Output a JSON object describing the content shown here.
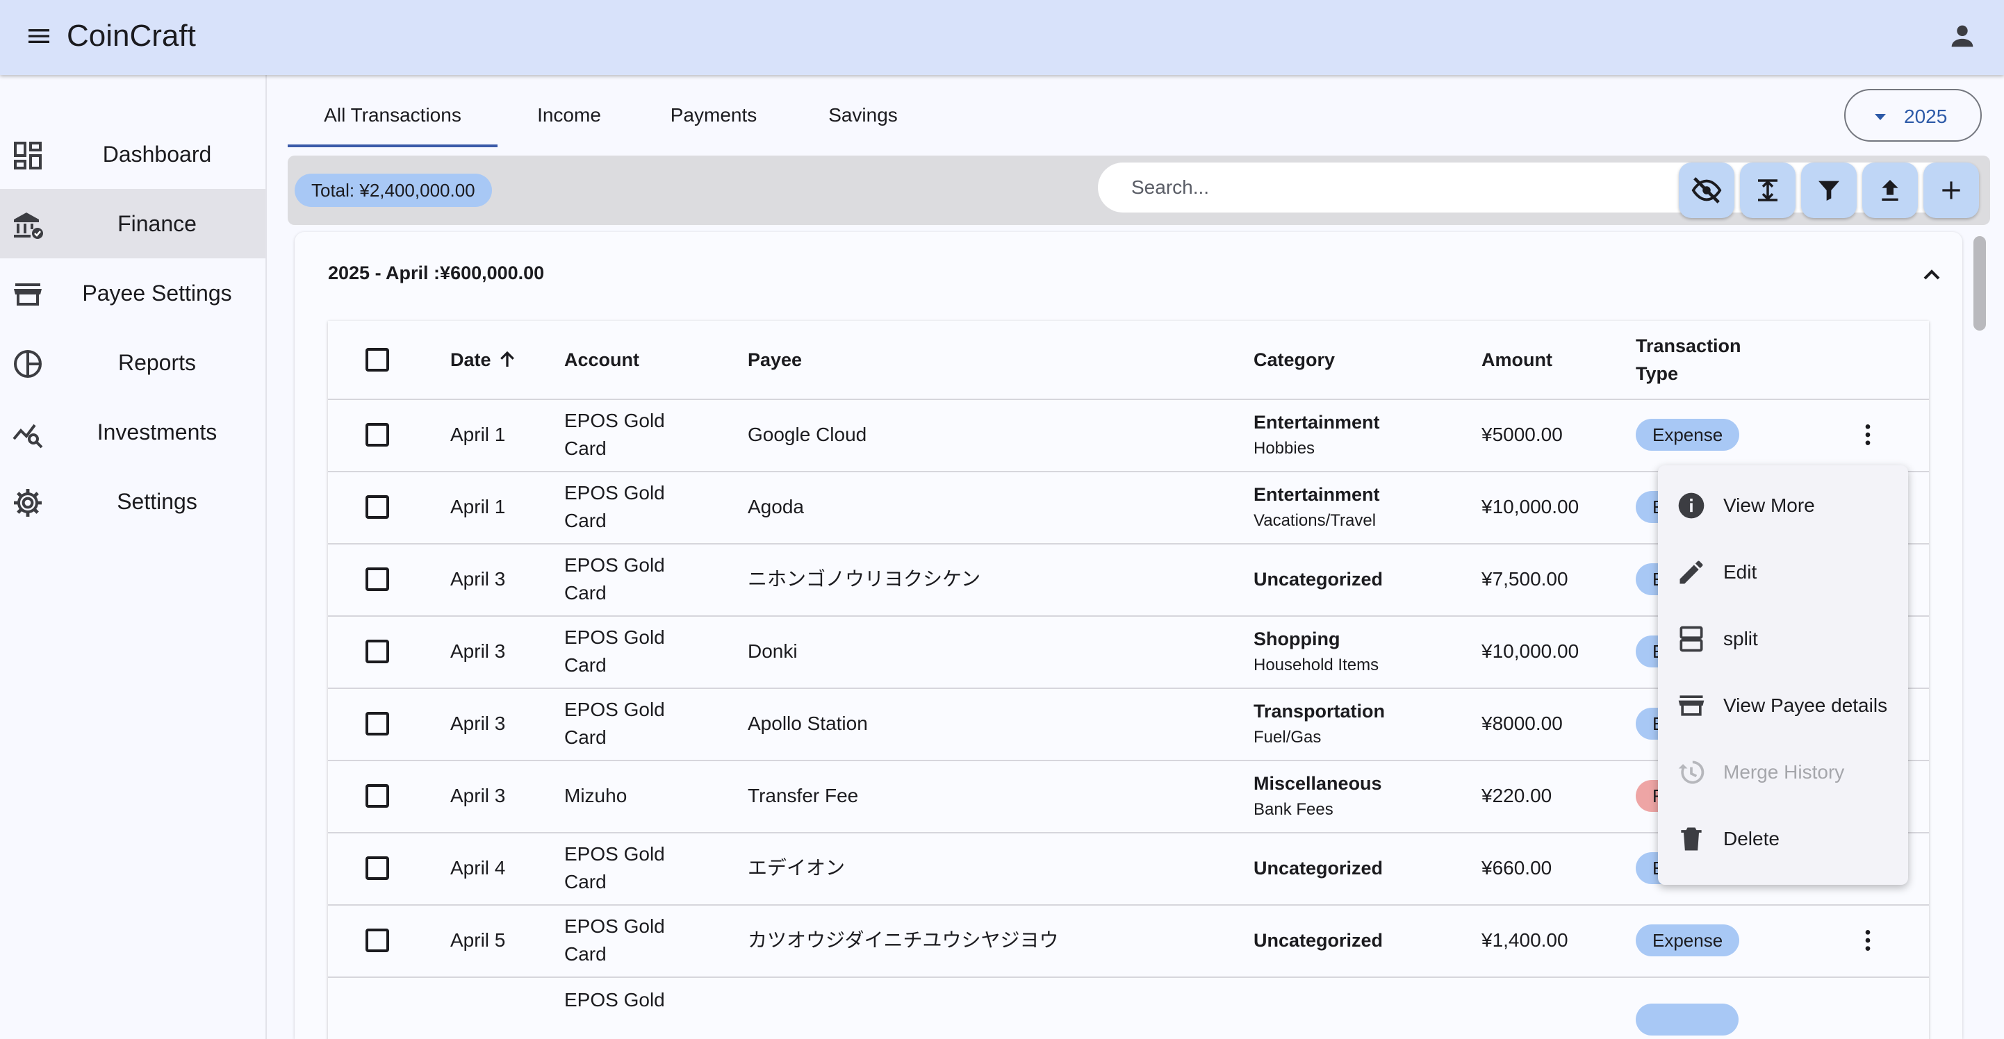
{
  "app": {
    "title": "CoinCraft"
  },
  "sidebar": {
    "items": [
      {
        "label": "Dashboard",
        "icon": "dashboard-icon",
        "active": false
      },
      {
        "label": "Finance",
        "icon": "bank-icon",
        "active": true
      },
      {
        "label": "Payee Settings",
        "icon": "store-icon",
        "active": false
      },
      {
        "label": "Reports",
        "icon": "pie-chart-icon",
        "active": false
      },
      {
        "label": "Investments",
        "icon": "trend-search-icon",
        "active": false
      },
      {
        "label": "Settings",
        "icon": "gear-icon",
        "active": false
      }
    ]
  },
  "tabs": [
    {
      "label": "All Transactions",
      "active": true
    },
    {
      "label": "Income",
      "active": false
    },
    {
      "label": "Payments",
      "active": false
    },
    {
      "label": "Savings",
      "active": false
    }
  ],
  "year_selector": {
    "value": "2025"
  },
  "toolbar": {
    "total": "Total: ¥2,400,000.00",
    "search_placeholder": "Search...",
    "buttons": [
      "visibility-off-icon",
      "expand-height-icon",
      "filter-icon",
      "upload-icon",
      "add-icon"
    ]
  },
  "group": {
    "title": "2025 - April :¥600,000.00"
  },
  "table": {
    "headers": {
      "date": "Date",
      "account": "Account",
      "payee": "Payee",
      "category": "Category",
      "amount": "Amount",
      "type_line1": "Transaction",
      "type_line2": "Type"
    },
    "rows": [
      {
        "date": "April 1",
        "account1": "EPOS Gold",
        "account2": "Card",
        "payee": "Google Cloud",
        "category": "Entertainment",
        "subcategory": "Hobbies",
        "amount": "¥5000.00",
        "type": "Expense"
      },
      {
        "date": "April 1",
        "account1": "EPOS Gold",
        "account2": "Card",
        "payee": "Agoda",
        "category": "Entertainment",
        "subcategory": "Vacations/Travel",
        "amount": "¥10,000.00",
        "type": "E"
      },
      {
        "date": "April 3",
        "account1": "EPOS Gold",
        "account2": "Card",
        "payee": "ニホンゴノウリヨクシケン",
        "category": "Uncategorized",
        "subcategory": "",
        "amount": "¥7,500.00",
        "type": "E"
      },
      {
        "date": "April 3",
        "account1": "EPOS Gold",
        "account2": "Card",
        "payee": "Donki",
        "category": "Shopping",
        "subcategory": "Household Items",
        "amount": "¥10,000.00",
        "type": "E"
      },
      {
        "date": "April 3",
        "account1": "EPOS Gold",
        "account2": "Card",
        "payee": "Apollo Station",
        "category": "Transportation",
        "subcategory": "Fuel/Gas",
        "amount": "¥8000.00",
        "type": "E"
      },
      {
        "date": "April 3",
        "account1": "Mizuho",
        "account2": "",
        "payee": "Transfer Fee",
        "category": "Miscellaneous",
        "subcategory": "Bank Fees",
        "amount": "¥220.00",
        "type": "F"
      },
      {
        "date": "April 4",
        "account1": "EPOS Gold",
        "account2": "Card",
        "payee": "エデイオン",
        "category": "Uncategorized",
        "subcategory": "",
        "amount": "¥660.00",
        "type": "E"
      },
      {
        "date": "April 5",
        "account1": "EPOS Gold",
        "account2": "Card",
        "payee": "カツオウジダイニチユウシヤジヨウ",
        "category": "Uncategorized",
        "subcategory": "",
        "amount": "¥1,400.00",
        "type": "Expense"
      },
      {
        "date": "",
        "account1": "EPOS Gold",
        "account2": "",
        "payee": "",
        "category": "",
        "subcategory": "",
        "amount": "",
        "type": ""
      }
    ]
  },
  "context_menu": {
    "items": [
      {
        "label": "View More",
        "icon": "info-icon",
        "disabled": false
      },
      {
        "label": "Edit",
        "icon": "pencil-icon",
        "disabled": false
      },
      {
        "label": "split",
        "icon": "split-icon",
        "disabled": false
      },
      {
        "label": "View Payee details",
        "icon": "store-icon",
        "disabled": false
      },
      {
        "label": "Merge History",
        "icon": "history-icon",
        "disabled": true
      },
      {
        "label": "Delete",
        "icon": "trash-icon",
        "disabled": false
      }
    ]
  },
  "colors": {
    "appbar": "#d8e2fa",
    "primary": "#2d5aa8",
    "expense_chip": "#a8c8f5",
    "fee_chip": "#eea5a5",
    "toolbar_button": "#bfd6f6"
  }
}
